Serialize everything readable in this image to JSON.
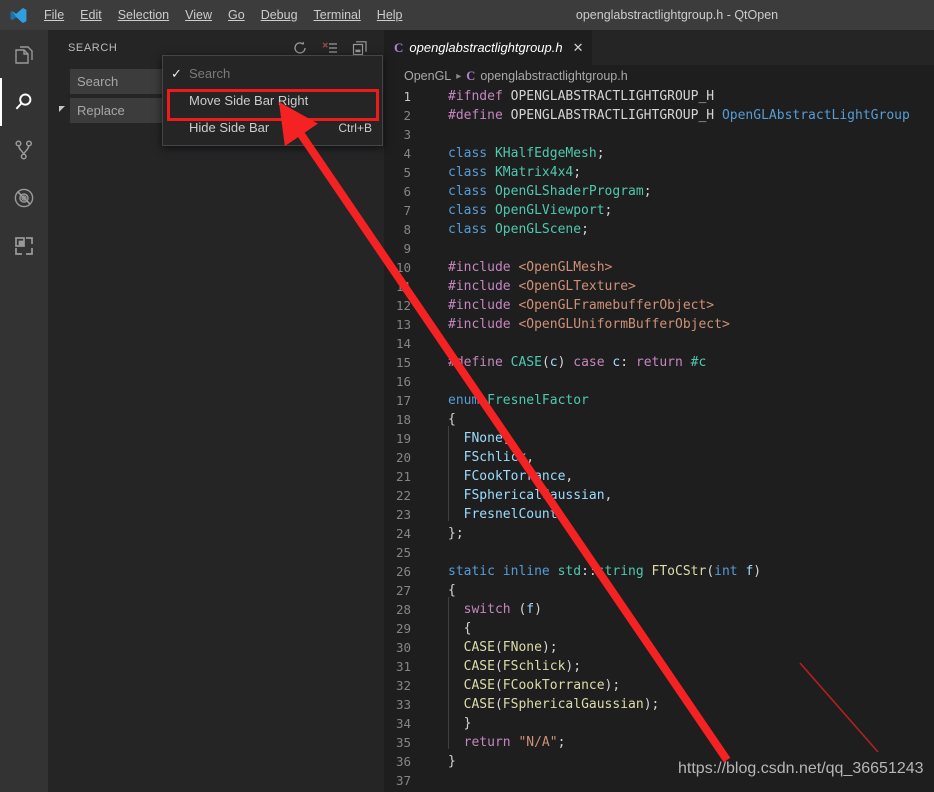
{
  "titlebar": {
    "logo_icon": "vscode-logo-icon",
    "window_title": "openglabstractlightgroup.h - QtOpen",
    "menus": [
      {
        "label": "File"
      },
      {
        "label": "Edit"
      },
      {
        "label": "Selection"
      },
      {
        "label": "View"
      },
      {
        "label": "Go"
      },
      {
        "label": "Debug"
      },
      {
        "label": "Terminal"
      },
      {
        "label": "Help"
      }
    ]
  },
  "activitybar": {
    "items": [
      {
        "name": "explorer",
        "icon": "files-icon",
        "active": false
      },
      {
        "name": "search",
        "icon": "search-icon",
        "active": true
      },
      {
        "name": "source-control",
        "icon": "source-control-icon",
        "active": false
      },
      {
        "name": "run-debug",
        "icon": "debug-alt-icon",
        "active": false
      },
      {
        "name": "extensions",
        "icon": "extensions-icon",
        "active": false
      }
    ]
  },
  "sidebar": {
    "title": "SEARCH",
    "actions": [
      {
        "name": "refresh",
        "icon": "refresh-icon"
      },
      {
        "name": "clear-search-results",
        "icon": "clear-all-icon"
      },
      {
        "name": "open-new-search-editor",
        "icon": "new-editor-icon"
      }
    ],
    "toggle_icon": "expand-triangle-icon",
    "search_placeholder": "Search",
    "search_value": "",
    "replace_placeholder": "Replace",
    "replace_value": ""
  },
  "context_menu": {
    "items": [
      {
        "check": "✓",
        "label": "Search",
        "shortcut": "",
        "dim": true,
        "highlighted": false
      },
      {
        "check": "",
        "label": "Move Side Bar Right",
        "shortcut": "",
        "dim": false,
        "highlighted": true
      },
      {
        "check": "",
        "label": "Hide Side Bar",
        "shortcut": "Ctrl+B",
        "dim": false,
        "highlighted": false
      }
    ],
    "highlight_color": "#f11a1a"
  },
  "editor": {
    "tab": {
      "icon_letter": "C",
      "label": "openglabstractlightgroup.h",
      "close_icon": "close-icon",
      "close_glyph": "✕"
    },
    "breadcrumb": {
      "root": "OpenGL",
      "separator": "▸",
      "file_icon_letter": "C",
      "file": "openglabstractlightgroup.h"
    },
    "lines": [
      {
        "n": "1",
        "active": true,
        "indent": false,
        "tokens": [
          {
            "t": "#ifndef ",
            "c": "t-pre"
          },
          {
            "t": "OPENGLABSTRACTLIGHTGROUP_H",
            "c": "t-mac"
          }
        ]
      },
      {
        "n": "2",
        "active": false,
        "indent": false,
        "tokens": [
          {
            "t": "#define ",
            "c": "t-pre"
          },
          {
            "t": "OPENGLABSTRACTLIGHTGROUP_H ",
            "c": "t-mac"
          },
          {
            "t": "OpenGLAbstractLightGroup",
            "c": "t-blue"
          }
        ]
      },
      {
        "n": "3",
        "active": false,
        "indent": false,
        "tokens": []
      },
      {
        "n": "4",
        "active": false,
        "indent": false,
        "tokens": [
          {
            "t": "class ",
            "c": "t-blue"
          },
          {
            "t": "KHalfEdgeMesh",
            "c": "t-type"
          },
          {
            "t": ";",
            "c": "t-plain"
          }
        ]
      },
      {
        "n": "5",
        "active": false,
        "indent": false,
        "tokens": [
          {
            "t": "class ",
            "c": "t-blue"
          },
          {
            "t": "KMatrix4x4",
            "c": "t-type"
          },
          {
            "t": ";",
            "c": "t-plain"
          }
        ]
      },
      {
        "n": "6",
        "active": false,
        "indent": false,
        "tokens": [
          {
            "t": "class ",
            "c": "t-blue"
          },
          {
            "t": "OpenGLShaderProgram",
            "c": "t-type"
          },
          {
            "t": ";",
            "c": "t-plain"
          }
        ]
      },
      {
        "n": "7",
        "active": false,
        "indent": false,
        "tokens": [
          {
            "t": "class ",
            "c": "t-blue"
          },
          {
            "t": "OpenGLViewport",
            "c": "t-type"
          },
          {
            "t": ";",
            "c": "t-plain"
          }
        ]
      },
      {
        "n": "8",
        "active": false,
        "indent": false,
        "tokens": [
          {
            "t": "class ",
            "c": "t-blue"
          },
          {
            "t": "OpenGLScene",
            "c": "t-type"
          },
          {
            "t": ";",
            "c": "t-plain"
          }
        ]
      },
      {
        "n": "9",
        "active": false,
        "indent": false,
        "tokens": []
      },
      {
        "n": "10",
        "active": false,
        "indent": false,
        "tokens": [
          {
            "t": "#include ",
            "c": "t-pre"
          },
          {
            "t": "<OpenGLMesh>",
            "c": "t-inc"
          }
        ]
      },
      {
        "n": "11",
        "active": false,
        "indent": false,
        "tokens": [
          {
            "t": "#include ",
            "c": "t-pre"
          },
          {
            "t": "<OpenGLTexture>",
            "c": "t-inc"
          }
        ]
      },
      {
        "n": "12",
        "active": false,
        "indent": false,
        "tokens": [
          {
            "t": "#include ",
            "c": "t-pre"
          },
          {
            "t": "<OpenGLFramebufferObject>",
            "c": "t-inc"
          }
        ]
      },
      {
        "n": "13",
        "active": false,
        "indent": false,
        "tokens": [
          {
            "t": "#include ",
            "c": "t-pre"
          },
          {
            "t": "<OpenGLUniformBufferObject>",
            "c": "t-inc"
          }
        ]
      },
      {
        "n": "14",
        "active": false,
        "indent": false,
        "tokens": []
      },
      {
        "n": "15",
        "active": false,
        "indent": false,
        "tokens": [
          {
            "t": "#define ",
            "c": "t-pre"
          },
          {
            "t": "CASE",
            "c": "t-type"
          },
          {
            "t": "(",
            "c": "t-plain"
          },
          {
            "t": "c",
            "c": "t-var"
          },
          {
            "t": ") ",
            "c": "t-plain"
          },
          {
            "t": "case ",
            "c": "t-pre"
          },
          {
            "t": "c",
            "c": "t-var"
          },
          {
            "t": ": ",
            "c": "t-plain"
          },
          {
            "t": "return ",
            "c": "t-pre"
          },
          {
            "t": "#c",
            "c": "t-type"
          }
        ]
      },
      {
        "n": "16",
        "active": false,
        "indent": false,
        "tokens": []
      },
      {
        "n": "17",
        "active": false,
        "indent": false,
        "tokens": [
          {
            "t": "enum ",
            "c": "t-blue"
          },
          {
            "t": "FresnelFactor",
            "c": "t-type"
          }
        ]
      },
      {
        "n": "18",
        "active": false,
        "indent": false,
        "tokens": [
          {
            "t": "{",
            "c": "t-plain"
          }
        ]
      },
      {
        "n": "19",
        "active": false,
        "indent": true,
        "tokens": [
          {
            "t": "  ",
            "c": "t-plain"
          },
          {
            "t": "FNone",
            "c": "t-var"
          },
          {
            "t": ",",
            "c": "t-plain"
          }
        ]
      },
      {
        "n": "20",
        "active": false,
        "indent": true,
        "tokens": [
          {
            "t": "  ",
            "c": "t-plain"
          },
          {
            "t": "FSchlick",
            "c": "t-var"
          },
          {
            "t": ",",
            "c": "t-plain"
          }
        ]
      },
      {
        "n": "21",
        "active": false,
        "indent": true,
        "tokens": [
          {
            "t": "  ",
            "c": "t-plain"
          },
          {
            "t": "FCookTorrance",
            "c": "t-var"
          },
          {
            "t": ",",
            "c": "t-plain"
          }
        ]
      },
      {
        "n": "22",
        "active": false,
        "indent": true,
        "tokens": [
          {
            "t": "  ",
            "c": "t-plain"
          },
          {
            "t": "FSphericalGaussian",
            "c": "t-var"
          },
          {
            "t": ",",
            "c": "t-plain"
          }
        ]
      },
      {
        "n": "23",
        "active": false,
        "indent": true,
        "tokens": [
          {
            "t": "  ",
            "c": "t-plain"
          },
          {
            "t": "FresnelCount",
            "c": "t-var"
          }
        ]
      },
      {
        "n": "24",
        "active": false,
        "indent": false,
        "tokens": [
          {
            "t": "};",
            "c": "t-plain"
          }
        ]
      },
      {
        "n": "25",
        "active": false,
        "indent": false,
        "tokens": []
      },
      {
        "n": "26",
        "active": false,
        "indent": false,
        "tokens": [
          {
            "t": "static ",
            "c": "t-blue"
          },
          {
            "t": "inline ",
            "c": "t-blue"
          },
          {
            "t": "std",
            "c": "t-type"
          },
          {
            "t": "::",
            "c": "t-plain"
          },
          {
            "t": "string ",
            "c": "t-type"
          },
          {
            "t": "FToCStr",
            "c": "t-fn"
          },
          {
            "t": "(",
            "c": "t-plain"
          },
          {
            "t": "int ",
            "c": "t-blue"
          },
          {
            "t": "f",
            "c": "t-var"
          },
          {
            "t": ")",
            "c": "t-plain"
          }
        ]
      },
      {
        "n": "27",
        "active": false,
        "indent": false,
        "tokens": [
          {
            "t": "{",
            "c": "t-plain"
          }
        ]
      },
      {
        "n": "28",
        "active": false,
        "indent": true,
        "tokens": [
          {
            "t": "  ",
            "c": "t-plain"
          },
          {
            "t": "switch ",
            "c": "t-pre"
          },
          {
            "t": "(",
            "c": "t-plain"
          },
          {
            "t": "f",
            "c": "t-var"
          },
          {
            "t": ")",
            "c": "t-plain"
          }
        ]
      },
      {
        "n": "29",
        "active": false,
        "indent": true,
        "tokens": [
          {
            "t": "  {",
            "c": "t-plain"
          }
        ]
      },
      {
        "n": "30",
        "active": false,
        "indent": true,
        "tokens": [
          {
            "t": "  ",
            "c": "t-plain"
          },
          {
            "t": "CASE",
            "c": "t-fn"
          },
          {
            "t": "(",
            "c": "t-plain"
          },
          {
            "t": "FNone",
            "c": "t-fn"
          },
          {
            "t": ");",
            "c": "t-plain"
          }
        ]
      },
      {
        "n": "31",
        "active": false,
        "indent": true,
        "tokens": [
          {
            "t": "  ",
            "c": "t-plain"
          },
          {
            "t": "CASE",
            "c": "t-fn"
          },
          {
            "t": "(",
            "c": "t-plain"
          },
          {
            "t": "FSchlick",
            "c": "t-fn"
          },
          {
            "t": ");",
            "c": "t-plain"
          }
        ]
      },
      {
        "n": "32",
        "active": false,
        "indent": true,
        "tokens": [
          {
            "t": "  ",
            "c": "t-plain"
          },
          {
            "t": "CASE",
            "c": "t-fn"
          },
          {
            "t": "(",
            "c": "t-plain"
          },
          {
            "t": "FCookTorrance",
            "c": "t-fn"
          },
          {
            "t": ");",
            "c": "t-plain"
          }
        ]
      },
      {
        "n": "33",
        "active": false,
        "indent": true,
        "tokens": [
          {
            "t": "  ",
            "c": "t-plain"
          },
          {
            "t": "CASE",
            "c": "t-fn"
          },
          {
            "t": "(",
            "c": "t-plain"
          },
          {
            "t": "FSphericalGaussian",
            "c": "t-fn"
          },
          {
            "t": ");",
            "c": "t-plain"
          }
        ]
      },
      {
        "n": "34",
        "active": false,
        "indent": true,
        "tokens": [
          {
            "t": "  }",
            "c": "t-plain"
          }
        ]
      },
      {
        "n": "35",
        "active": false,
        "indent": true,
        "tokens": [
          {
            "t": "  ",
            "c": "t-plain"
          },
          {
            "t": "return ",
            "c": "t-pre"
          },
          {
            "t": "\"N/A\"",
            "c": "t-str"
          },
          {
            "t": ";",
            "c": "t-plain"
          }
        ]
      },
      {
        "n": "36",
        "active": false,
        "indent": false,
        "tokens": [
          {
            "t": "}",
            "c": "t-plain"
          }
        ]
      },
      {
        "n": "37",
        "active": false,
        "indent": false,
        "tokens": []
      }
    ]
  },
  "annotations": {
    "arrow_color": "#f42222",
    "watermark": "https://blog.csdn.net/qq_36651243"
  }
}
